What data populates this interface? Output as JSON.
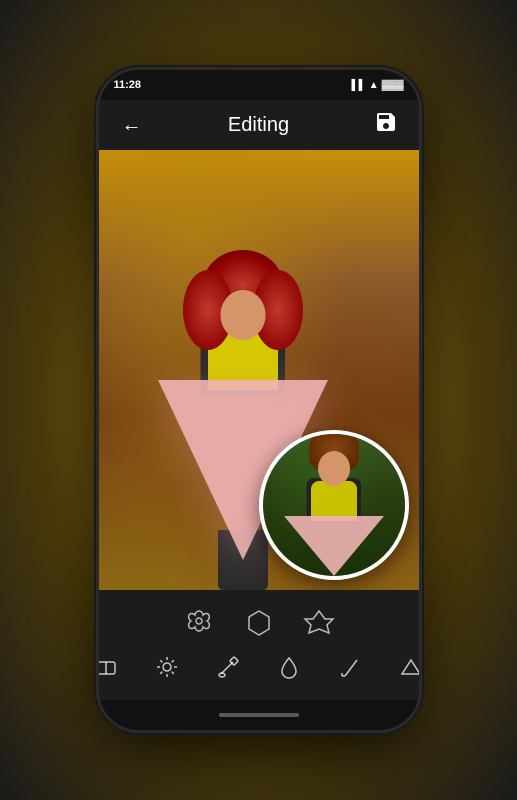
{
  "app": {
    "title": "Editing",
    "status": {
      "time": "11:28",
      "signal": "▌▌",
      "wifi": "WiFi",
      "battery": "▓▓▓"
    },
    "back_label": "←",
    "save_label": "💾"
  },
  "toolbar": {
    "shapes": [
      {
        "name": "flower-shape",
        "icon": "✿"
      },
      {
        "name": "hexagon-shape",
        "icon": "⬡"
      },
      {
        "name": "star-shape",
        "icon": "✦"
      }
    ],
    "tools": [
      {
        "name": "eraser-tool",
        "icon": "◈"
      },
      {
        "name": "brightness-tool",
        "icon": "✳"
      },
      {
        "name": "brush-tool",
        "icon": "/"
      },
      {
        "name": "water-tool",
        "icon": "💧"
      },
      {
        "name": "pencil-tool",
        "icon": "∕"
      },
      {
        "name": "triangle-tool",
        "icon": "△"
      }
    ]
  }
}
